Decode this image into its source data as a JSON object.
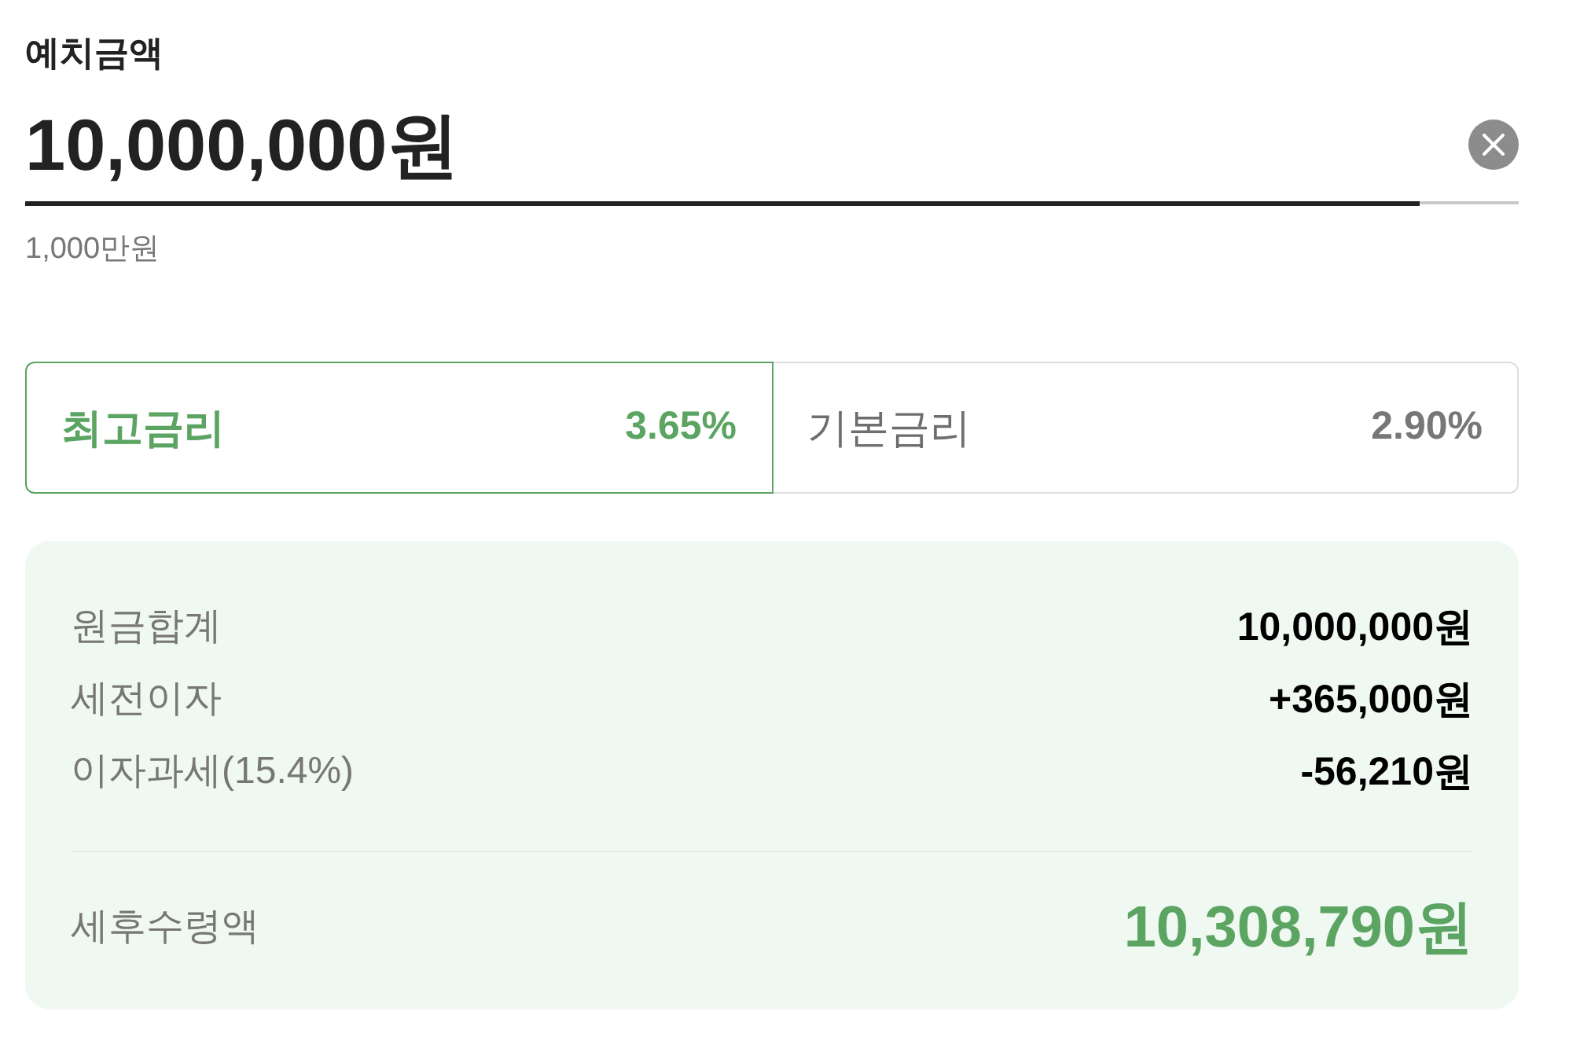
{
  "deposit": {
    "label": "예치금액",
    "value": "10,000,000원",
    "helper_text": "1,000만원"
  },
  "rate_tabs": [
    {
      "label": "최고금리",
      "rate": "3.65%",
      "selected": true
    },
    {
      "label": "기본금리",
      "rate": "2.90%",
      "selected": false
    }
  ],
  "summary": {
    "rows": [
      {
        "label": "원금합계",
        "value": "10,000,000원"
      },
      {
        "label": "세전이자",
        "value": "+365,000원"
      },
      {
        "label": "이자과세(15.4%)",
        "value": "-56,210원"
      }
    ],
    "total": {
      "label": "세후수령액",
      "value": "10,308,790원"
    }
  }
}
